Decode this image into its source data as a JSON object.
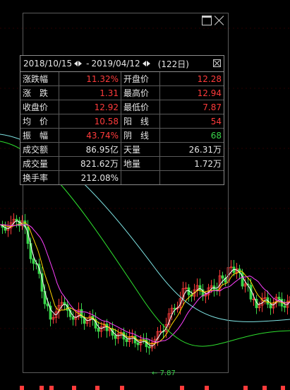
{
  "header": {
    "start_date": "2018/10/15",
    "end_date": "2019/04/12",
    "range_sep": "-",
    "days": "(122日)"
  },
  "stats": [
    {
      "l1": "涨跌幅",
      "v1": "11.32%",
      "c1": "red",
      "l2": "开盘价",
      "v2": "12.28",
      "c2": "red"
    },
    {
      "l1": "涨　跌",
      "v1": "1.31",
      "c1": "red",
      "l2": "最高价",
      "v2": "12.94",
      "c2": "red"
    },
    {
      "l1": "收盘价",
      "v1": "12.92",
      "c1": "red",
      "l2": "最低价",
      "v2": "7.87",
      "c2": "red"
    },
    {
      "l1": "均　价",
      "v1": "10.58",
      "c1": "red",
      "l2": "阳　线",
      "v2": "54",
      "c2": "red"
    },
    {
      "l1": "振　幅",
      "v1": "43.74%",
      "c1": "red",
      "l2": "阴　线",
      "v2": "68",
      "c2": "green"
    },
    {
      "l1": "成交额",
      "v1": "86.95亿",
      "c1": "white",
      "l2": "天量",
      "v2": "26.31万",
      "c2": "white"
    },
    {
      "l1": "成交量",
      "v1": "821.62万",
      "c1": "white",
      "l2": "地量",
      "v2": "1.72万",
      "c2": "white"
    },
    {
      "l1": "换手率",
      "v1": "212.08%",
      "c1": "white",
      "l2": "",
      "v2": "",
      "c2": "white"
    }
  ],
  "low_marker": "7.87",
  "colors": {
    "up": "#ff3b3b",
    "down": "#39d64a",
    "ma5": "#ffffff",
    "ma10": "#ffd400",
    "ma20": "#ff40ff",
    "ma30": "#2ee02e",
    "ma60": "#7fe5e5"
  }
}
